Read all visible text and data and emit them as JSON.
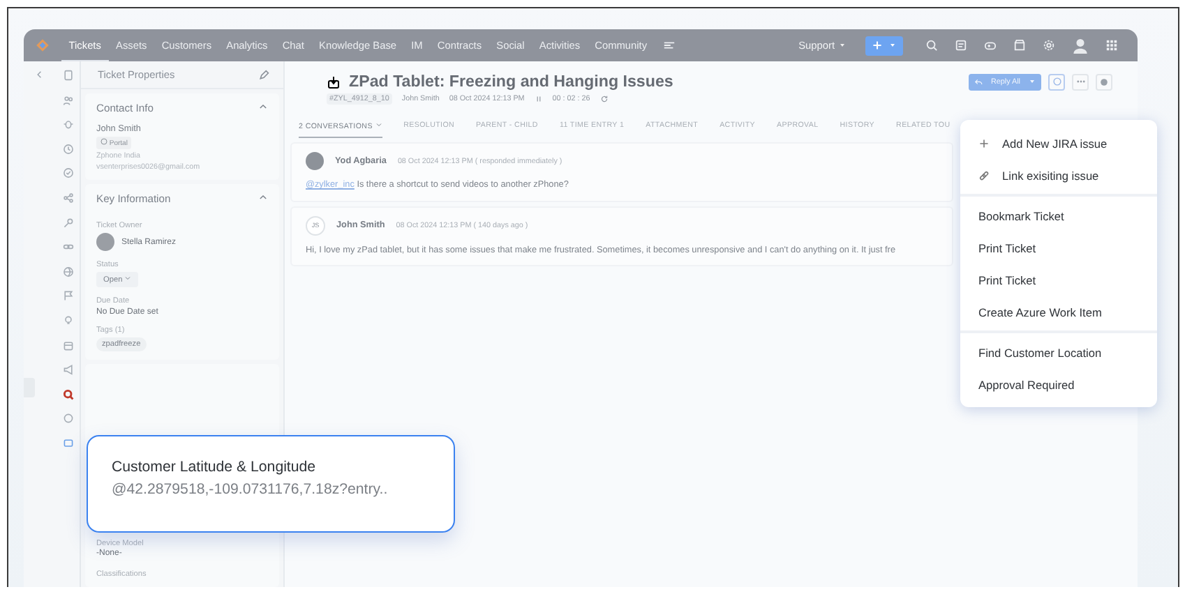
{
  "nav": {
    "tabs": [
      {
        "label": "Tickets",
        "selected": true
      },
      {
        "label": "Assets",
        "selected": false
      },
      {
        "label": "Customers",
        "selected": false
      },
      {
        "label": "Analytics",
        "selected": false
      },
      {
        "label": "Chat",
        "selected": false
      },
      {
        "label": "Knowledge Base",
        "selected": false
      },
      {
        "label": "IM",
        "selected": false
      },
      {
        "label": "Contracts",
        "selected": false
      },
      {
        "label": "Social",
        "selected": false
      },
      {
        "label": "Activities",
        "selected": false
      },
      {
        "label": "Community",
        "selected": false
      }
    ],
    "department": "Support"
  },
  "properties": {
    "title": "Ticket Properties",
    "contact": {
      "heading": "Contact Info",
      "name": "John Smith",
      "badge": "Portal",
      "company": "Zphone India",
      "email": "vsenterprises0026@gmail.com"
    },
    "key_info": {
      "heading": "Key Information",
      "owner_label": "Ticket Owner",
      "owner": "Stella Ramirez",
      "status_label": "Status",
      "status": "Open",
      "due_label": "Due Date",
      "due": "No Due Date set",
      "tags_label": "Tags (1)",
      "tags": [
        "zpadfreeze"
      ]
    },
    "extra": {
      "device_label": "Device Model",
      "device": "-None-",
      "class_label": "Classifications"
    }
  },
  "ticket": {
    "title": "ZPad Tablet: Freezing and Hanging Issues",
    "id": "#ZYL_4912_8_10",
    "contact": "John Smith",
    "created": "08 Oct 2024 12:13 PM",
    "timer": "00 : 02 : 26",
    "reply_button": "Reply All",
    "tabs": [
      {
        "label": "2 CONVERSATIONS",
        "selected": true
      },
      {
        "label": "RESOLUTION",
        "selected": false
      },
      {
        "label": "PARENT - CHILD",
        "selected": false
      },
      {
        "label": "11 TIME ENTRY 1",
        "selected": false
      },
      {
        "label": "ATTACHMENT",
        "selected": false
      },
      {
        "label": "ACTIVITY",
        "selected": false
      },
      {
        "label": "APPROVAL",
        "selected": false
      },
      {
        "label": "HISTORY",
        "selected": false
      },
      {
        "label": "RELATED TOU",
        "selected": false
      }
    ],
    "conversations": [
      {
        "kind": "photo",
        "author": "Yod Agbaria",
        "time": "08 Oct 2024 12:13 PM ( responded immediately )",
        "mention": "@zylker_inc",
        "text": "Is there a shortcut to send videos to another zPhone?"
      },
      {
        "kind": "initials",
        "initials": "JS",
        "author": "John Smith",
        "time": "08 Oct 2024 12:13 PM ( 140 days ago )",
        "text": "Hi, I love my zPad tablet, but it has some issues that make me frustrated. Sometimes, it becomes unresponsive and I can't do anything on it. It just fre"
      }
    ]
  },
  "menu": {
    "groups": [
      [
        {
          "kind": "add",
          "label": "Add New JIRA issue"
        },
        {
          "kind": "link",
          "label": "Link exisiting issue"
        }
      ],
      [
        {
          "kind": "plain",
          "label": "Bookmark Ticket"
        },
        {
          "kind": "plain",
          "label": "Print Ticket"
        },
        {
          "kind": "plain",
          "label": "Print Ticket"
        },
        {
          "kind": "plain",
          "label": "Create Azure Work Item"
        }
      ],
      [
        {
          "kind": "plain",
          "label": "Find Customer Location"
        },
        {
          "kind": "plain",
          "label": "Approval Required"
        }
      ]
    ]
  },
  "callout": {
    "title": "Customer Latitude & Longitude",
    "value": "@42.2879518,-109.0731176,7.18z?entry.."
  }
}
